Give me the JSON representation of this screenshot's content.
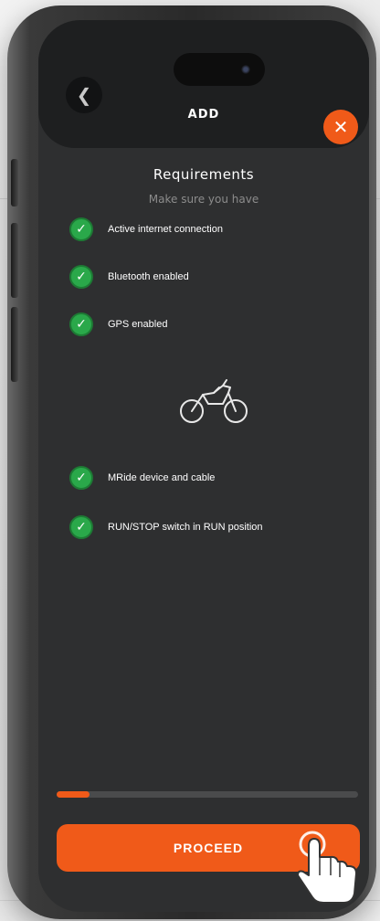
{
  "header": {
    "title": "ADD",
    "back_icon": "chevron-left-icon",
    "close_icon": "close-icon"
  },
  "requirements": {
    "title": "Requirements",
    "subtitle": "Make sure you have",
    "items": [
      {
        "label": "Active internet connection",
        "checked": true
      },
      {
        "label": "Bluetooth enabled",
        "checked": true
      },
      {
        "label": "GPS enabled",
        "checked": true
      },
      {
        "label": "MRide device and cable",
        "checked": true
      },
      {
        "label": "RUN/STOP switch in RUN position",
        "checked": true
      }
    ],
    "illustration_icon": "motorcycle-icon"
  },
  "progress": {
    "value": 0.11
  },
  "footer": {
    "proceed_label": "PROCEED"
  },
  "colors": {
    "accent": "#f05a19",
    "check_green": "#2aa84a",
    "screen_bg": "#2e2f30",
    "header_bg": "#1e1f20"
  }
}
